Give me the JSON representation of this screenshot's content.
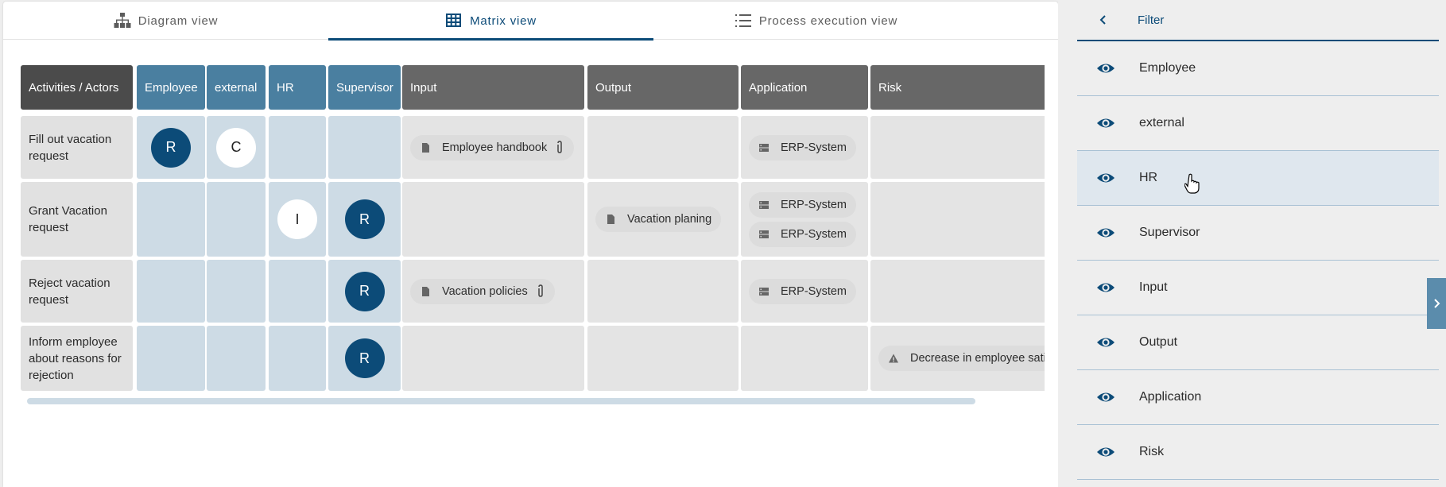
{
  "tabs": [
    {
      "label": "Diagram view",
      "icon": "diagram-icon",
      "active": false
    },
    {
      "label": "Matrix view",
      "icon": "grid-icon",
      "active": true
    },
    {
      "label": "Process execution view",
      "icon": "numbered-list-icon",
      "active": false
    }
  ],
  "matrix": {
    "corner_label": "Activities / Actors",
    "actor_columns": [
      "Employee",
      "external",
      "HR",
      "Supervisor"
    ],
    "object_columns": [
      "Input",
      "Output",
      "Application",
      "Risk"
    ],
    "rows": [
      {
        "activity": "Fill out vacation request",
        "raci": {
          "Employee": "R",
          "external": "C",
          "HR": "",
          "Supervisor": ""
        },
        "Input": [
          {
            "label": "Employee handbook",
            "icon": "document-icon",
            "attachment": true
          }
        ],
        "Output": [],
        "Application": [
          {
            "label": "ERP-System",
            "icon": "server-icon"
          }
        ],
        "Risk": []
      },
      {
        "activity": "Grant Vacation request",
        "raci": {
          "Employee": "",
          "external": "",
          "HR": "I",
          "Supervisor": "R"
        },
        "Input": [],
        "Output": [
          {
            "label": "Vacation planing",
            "icon": "document-icon",
            "attachment": false
          }
        ],
        "Application": [
          {
            "label": "ERP-System",
            "icon": "server-icon"
          },
          {
            "label": "ERP-System",
            "icon": "server-icon"
          }
        ],
        "Risk": []
      },
      {
        "activity": "Reject vacation request",
        "raci": {
          "Employee": "",
          "external": "",
          "HR": "",
          "Supervisor": "R"
        },
        "Input": [
          {
            "label": "Vacation policies",
            "icon": "document-icon",
            "attachment": true
          }
        ],
        "Output": [],
        "Application": [
          {
            "label": "ERP-System",
            "icon": "server-icon"
          }
        ],
        "Risk": []
      },
      {
        "activity": "Inform employee about reasons for rejection",
        "raci": {
          "Employee": "",
          "external": "",
          "HR": "",
          "Supervisor": "R"
        },
        "Input": [],
        "Output": [],
        "Application": [],
        "Risk": [
          {
            "label": "Decrease in employee satisfaction",
            "icon": "warning-icon"
          }
        ]
      }
    ]
  },
  "filter": {
    "title": "Filter",
    "items": [
      "Employee",
      "external",
      "HR",
      "Supervisor",
      "Input",
      "Output",
      "Application",
      "Risk"
    ],
    "hovered": "HR"
  },
  "colors": {
    "accent": "#0c4b78",
    "actor_header": "#4a7fa0",
    "object_header": "#676767",
    "actor_cell": "#cddbe5",
    "object_cell": "#e4e4e4"
  }
}
